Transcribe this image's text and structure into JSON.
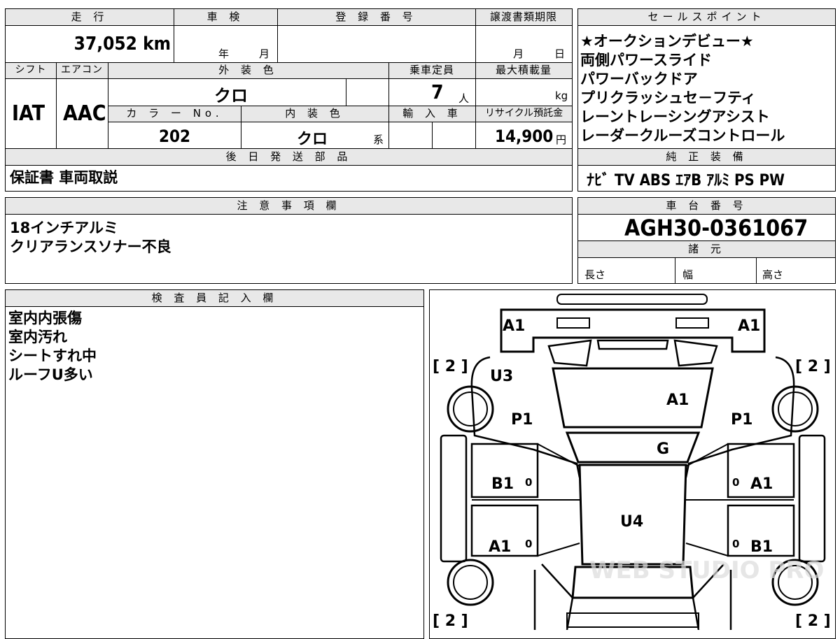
{
  "labels": {
    "mileage": "走 行",
    "shaken": "車 検",
    "registration_number": "登 録 番 号",
    "transfer_deadline": "譲渡書類期限",
    "sales_points": "セールスポイント",
    "shift": "シフト",
    "aircon": "エアコン",
    "exterior_color": "外 装 色",
    "capacity": "乗車定員",
    "max_load": "最大積載量",
    "color_no": "カ ラ ー No.",
    "interior_color": "内 装 色",
    "import": "輸 入 車",
    "recycle": "リサイクル預託金",
    "later_parts": "後 日 発 送 部 品",
    "genuine_equipment": "純 正 装 備",
    "notes": "注 意 事 項 欄",
    "chassis_number": "車 台 番 号",
    "specs": "諸 元",
    "inspector_notes": "検 査 員 記 入 欄",
    "year_unit": "年",
    "month_unit": "月",
    "day_unit": "日",
    "persons_unit": "人",
    "kg_unit": "kg",
    "yen_unit": "円",
    "kei_unit": "系",
    "length": "長さ",
    "width": "幅",
    "height": "高さ"
  },
  "values": {
    "mileage": "37,052 km",
    "shift": "IAT",
    "aircon": "AAC",
    "exterior_color": "クロ",
    "capacity": "7",
    "color_no": "202",
    "interior_color": "クロ",
    "recycle_fee": "14,900",
    "later_parts": "保証書 車両取説",
    "genuine_equipment": "ﾅﾋﾞ TV ABS ｴｱB ｱﾙﾐ PS PW",
    "chassis_number": "AGH30-0361067"
  },
  "sales_points": [
    "★オークションデビュー★",
    "両側パワースライド",
    "パワーバックドア",
    "プリクラッシュセ－フティ",
    "レーントレーシングアシスト",
    "レーダークルーズコントロール"
  ],
  "notes": [
    "18インチアルミ",
    "クリアランスソナー不良"
  ],
  "inspector_notes": [
    "室内内張傷",
    "室内汚れ",
    "シートすれ中",
    "ルーフU多い"
  ],
  "damage_marks": {
    "a1_front_left": "A1",
    "a1_front_right": "A1",
    "tire_front_left": "[ 2 ]",
    "tire_front_right": "[ 2 ]",
    "tire_rear_left": "[ 2 ]",
    "tire_rear_right": "[ 2 ]",
    "u3": "U3",
    "hood": "A1",
    "p1_left": "P1",
    "p1_right": "P1",
    "windshield": "G",
    "b1_left": "B1",
    "a1_right_door": "A1",
    "roof": "U4",
    "a1_left_rear": "A1",
    "b1_right_rear": "B1",
    "zero_1": "0",
    "zero_2": "0",
    "zero_3": "0",
    "zero_4": "0"
  },
  "watermark": "WEB STUDIO PRO"
}
